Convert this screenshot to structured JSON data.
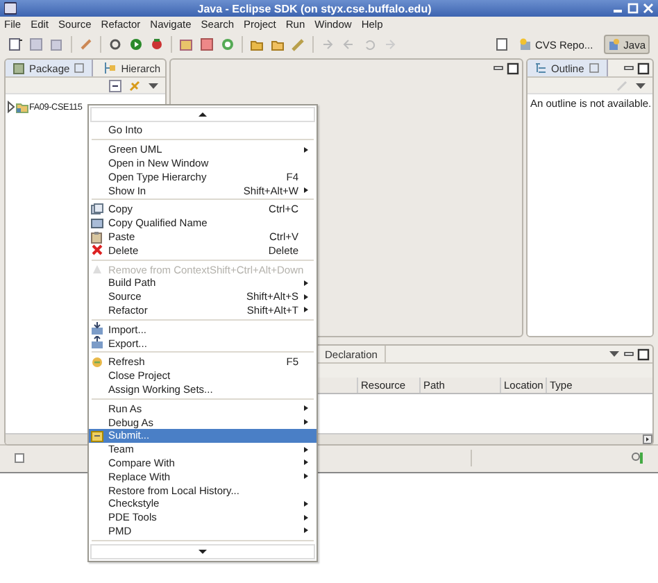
{
  "window": {
    "title": "Java - Eclipse SDK  (on styx.cse.buffalo.edu)"
  },
  "menubar": [
    "File",
    "Edit",
    "Source",
    "Refactor",
    "Navigate",
    "Search",
    "Project",
    "Run",
    "Window",
    "Help"
  ],
  "perspectives": [
    {
      "label": "CVS Repo...",
      "selected": false
    },
    {
      "label": "Java",
      "selected": true
    }
  ],
  "package_explorer": {
    "tabs": [
      {
        "label": "Package",
        "selected": true
      },
      {
        "label": "Hierarch",
        "selected": false
      }
    ],
    "tree": [
      {
        "label": "FA09-CSE115",
        "expanded": false
      }
    ]
  },
  "outline": {
    "tab": "Outline",
    "message": "An outline is not available."
  },
  "bottom_panel": {
    "tabs": [
      {
        "label": "Declaration",
        "selected": false
      }
    ],
    "columns": [
      "Resource",
      "Path",
      "Location",
      "Type"
    ]
  },
  "context_menu": {
    "items": [
      {
        "kind": "item",
        "label": "Go Into",
        "submenu": false,
        "disabled": false,
        "selected": false
      },
      {
        "kind": "separator"
      },
      {
        "kind": "item",
        "label": "Green UML",
        "submenu": true,
        "disabled": false,
        "selected": false
      },
      {
        "kind": "item",
        "label": "Open in New Window",
        "submenu": false,
        "disabled": false,
        "selected": false
      },
      {
        "kind": "item",
        "label": "Open Type Hierarchy",
        "shortcut": "F4",
        "submenu": false,
        "disabled": false,
        "selected": false
      },
      {
        "kind": "item",
        "label": "Show In",
        "shortcut": "Shift+Alt+W",
        "submenu": true,
        "disabled": false,
        "selected": false
      },
      {
        "kind": "separator"
      },
      {
        "kind": "item",
        "label": "Copy",
        "shortcut": "Ctrl+C",
        "submenu": false,
        "disabled": false,
        "selected": false
      },
      {
        "kind": "item",
        "label": "Copy Qualified Name",
        "submenu": false,
        "disabled": false,
        "selected": false
      },
      {
        "kind": "item",
        "label": "Paste",
        "shortcut": "Ctrl+V",
        "submenu": false,
        "disabled": false,
        "selected": false
      },
      {
        "kind": "item",
        "label": "Delete",
        "shortcut": "Delete",
        "submenu": false,
        "disabled": false,
        "selected": false
      },
      {
        "kind": "separator"
      },
      {
        "kind": "item",
        "label": "Remove from Context",
        "shortcut": "Shift+Ctrl+Alt+Down",
        "submenu": false,
        "disabled": true,
        "selected": false
      },
      {
        "kind": "item",
        "label": "Build Path",
        "submenu": true,
        "disabled": false,
        "selected": false
      },
      {
        "kind": "item",
        "label": "Source",
        "shortcut": "Shift+Alt+S",
        "submenu": true,
        "disabled": false,
        "selected": false
      },
      {
        "kind": "item",
        "label": "Refactor",
        "shortcut": "Shift+Alt+T",
        "submenu": true,
        "disabled": false,
        "selected": false
      },
      {
        "kind": "separator"
      },
      {
        "kind": "item",
        "label": "Import...",
        "submenu": false,
        "disabled": false,
        "selected": false
      },
      {
        "kind": "item",
        "label": "Export...",
        "submenu": false,
        "disabled": false,
        "selected": false
      },
      {
        "kind": "separator"
      },
      {
        "kind": "item",
        "label": "Refresh",
        "shortcut": "F5",
        "submenu": false,
        "disabled": false,
        "selected": false
      },
      {
        "kind": "item",
        "label": "Close Project",
        "submenu": false,
        "disabled": false,
        "selected": false
      },
      {
        "kind": "item",
        "label": "Assign Working Sets...",
        "submenu": false,
        "disabled": false,
        "selected": false
      },
      {
        "kind": "separator"
      },
      {
        "kind": "item",
        "label": "Run As",
        "submenu": true,
        "disabled": false,
        "selected": false
      },
      {
        "kind": "item",
        "label": "Debug As",
        "submenu": true,
        "disabled": false,
        "selected": false
      },
      {
        "kind": "item",
        "label": "Submit...",
        "submenu": false,
        "disabled": false,
        "selected": true
      },
      {
        "kind": "item",
        "label": "Team",
        "submenu": true,
        "disabled": false,
        "selected": false
      },
      {
        "kind": "item",
        "label": "Compare With",
        "submenu": true,
        "disabled": false,
        "selected": false
      },
      {
        "kind": "item",
        "label": "Replace With",
        "submenu": true,
        "disabled": false,
        "selected": false
      },
      {
        "kind": "item",
        "label": "Restore from Local History...",
        "submenu": false,
        "disabled": false,
        "selected": false
      },
      {
        "kind": "item",
        "label": "Checkstyle",
        "submenu": true,
        "disabled": false,
        "selected": false
      },
      {
        "kind": "item",
        "label": "PDE Tools",
        "submenu": true,
        "disabled": false,
        "selected": false
      },
      {
        "kind": "item",
        "label": "PMD",
        "submenu": true,
        "disabled": false,
        "selected": false
      },
      {
        "kind": "separator"
      }
    ]
  }
}
